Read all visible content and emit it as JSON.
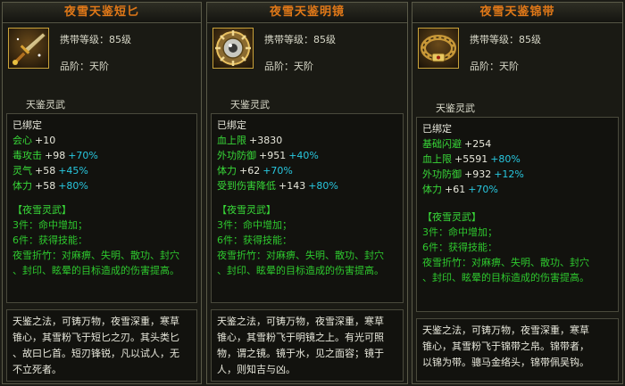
{
  "panels": [
    {
      "title": "夜雪天鉴短匕",
      "icon": "dagger-icon",
      "req": "携带等级：85级",
      "grade": "品阶：天阶",
      "name": "天鉴灵武",
      "bound": "已绑定",
      "stats": [
        {
          "label": "会心",
          "base": "+10",
          "bonus": ""
        },
        {
          "label": "毒攻击",
          "base": "+98",
          "bonus": "+70%"
        },
        {
          "label": "灵气",
          "base": "+58",
          "bonus": "+45%"
        },
        {
          "label": "体力",
          "base": "+58",
          "bonus": "+80%"
        }
      ],
      "set_title": "【夜雪灵武】",
      "set3": "3件：命中增加；",
      "set6": "6件：获得技能：",
      "skill1": "夜雪折竹：对麻痹、失明、散功、封穴",
      "skill2": "、封印、眩晕的目标造成的伤害提高。",
      "lore": [
        "天鉴之法，可铸万物，夜雪深重，寒草",
        "锥心，其雪粉飞于短匕之刃。其头类匕",
        "、故曰匕首。短刃锋锐，凡以试人，无",
        "不立死者。"
      ]
    },
    {
      "title": "夜雪天鉴明镜",
      "icon": "mirror-icon",
      "req": "携带等级：85级",
      "grade": "品阶：天阶",
      "name": "天鉴灵武",
      "bound": "已绑定",
      "stats": [
        {
          "label": "血上限",
          "base": "+3830",
          "bonus": ""
        },
        {
          "label": "外功防御",
          "base": "+951",
          "bonus": "+40%"
        },
        {
          "label": "体力",
          "base": "+62",
          "bonus": "+70%"
        },
        {
          "label": "受到伤害降低",
          "base": "+143",
          "bonus": "+80%"
        }
      ],
      "set_title": "【夜雪灵武】",
      "set3": "3件：命中增加；",
      "set6": "6件：获得技能：",
      "skill1": "夜雪折竹：对麻痹、失明、散功、封穴",
      "skill2": "、封印、眩晕的目标造成的伤害提高。",
      "lore": [
        "天鉴之法，可铸万物，夜雪深重，寒草",
        "锥心，其雪粉飞于明镜之上。有光可照",
        "物，谓之镜。镜于水，见之面容；镜于",
        "人，则知吉与凶。"
      ]
    },
    {
      "title": "夜雪天鉴锦带",
      "icon": "belt-icon",
      "req": "携带等级：85级",
      "grade": "品阶：天阶",
      "name": "天鉴灵武",
      "bound": "已绑定",
      "stats": [
        {
          "label": "基础闪避",
          "base": "+254",
          "bonus": ""
        },
        {
          "label": "血上限",
          "base": "+5591",
          "bonus": "+80%"
        },
        {
          "label": "外功防御",
          "base": "+932",
          "bonus": "+12%"
        },
        {
          "label": "体力",
          "base": "+61",
          "bonus": "+70%"
        }
      ],
      "set_title": "【夜雪灵武】",
      "set3": "3件：命中增加；",
      "set6": "6件：获得技能：",
      "skill1": "夜雪折竹：对麻痹、失明、散功、封穴",
      "skill2": "、封印、眩晕的目标造成的伤害提高。",
      "lore": [
        "天鉴之法，可铸万物，夜雪深重，寒草",
        "锥心，其雪粉飞于锦带之帛。锦带者，",
        "以锦为带。骢马金络头，锦带佩吴钩。"
      ]
    }
  ]
}
